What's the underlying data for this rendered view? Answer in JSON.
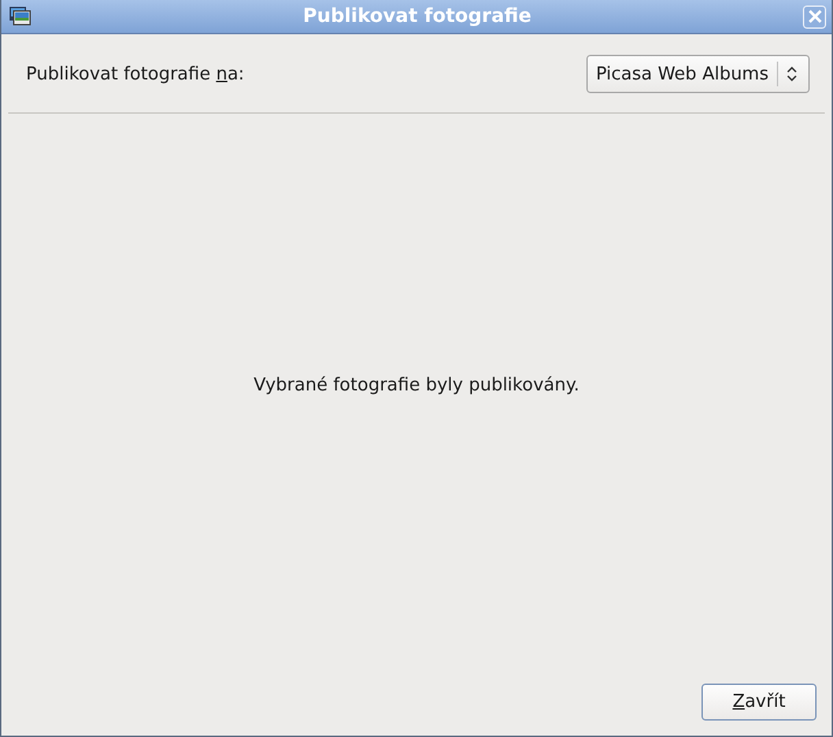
{
  "window": {
    "title": "Publikovat fotografie"
  },
  "service_label": {
    "before": "Publikovat fotografie ",
    "mnemonic": "n",
    "after": "a:"
  },
  "service_dropdown": {
    "value": "Picasa Web Albums"
  },
  "message": "Vybrané fotografie byly publikovány.",
  "close_button": {
    "mnemonic": "Z",
    "after": "avřít"
  }
}
